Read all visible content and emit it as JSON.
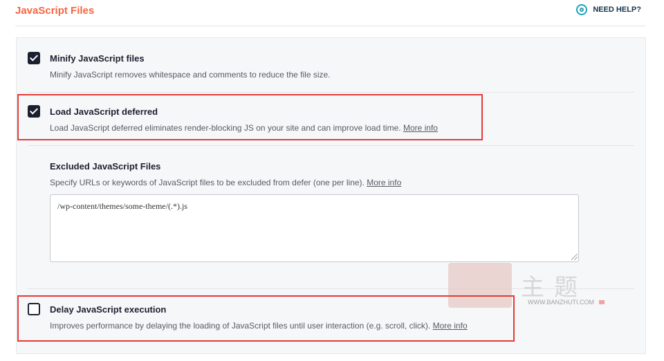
{
  "header": {
    "title": "JavaScript Files",
    "help_label": "NEED HELP?"
  },
  "options": {
    "minify": {
      "checked": true,
      "label": "Minify JavaScript files",
      "description": "Minify JavaScript removes whitespace and comments to reduce the file size."
    },
    "defer": {
      "checked": true,
      "label": "Load JavaScript deferred",
      "description": "Load JavaScript deferred eliminates render-blocking JS on your site and can improve load time.",
      "more_info": "More info"
    },
    "excluded": {
      "label": "Excluded JavaScript Files",
      "description": "Specify URLs or keywords of JavaScript files to be excluded from defer (one per line).",
      "more_info": "More info",
      "value": "/wp-content/themes/some-theme/(.*).js"
    },
    "delay": {
      "checked": false,
      "label": "Delay JavaScript execution",
      "description": "Improves performance by delaying the loading of JavaScript files until user interaction (e.g. scroll, click).",
      "more_info": "More info"
    }
  },
  "watermark": {
    "chars": "主题",
    "url": "WWW.BANZHUTI.COM"
  },
  "colors": {
    "title": "#f56640",
    "highlight": "#e53935",
    "checkbox": "#1b2030",
    "help_icon": "#1fa1b8"
  }
}
